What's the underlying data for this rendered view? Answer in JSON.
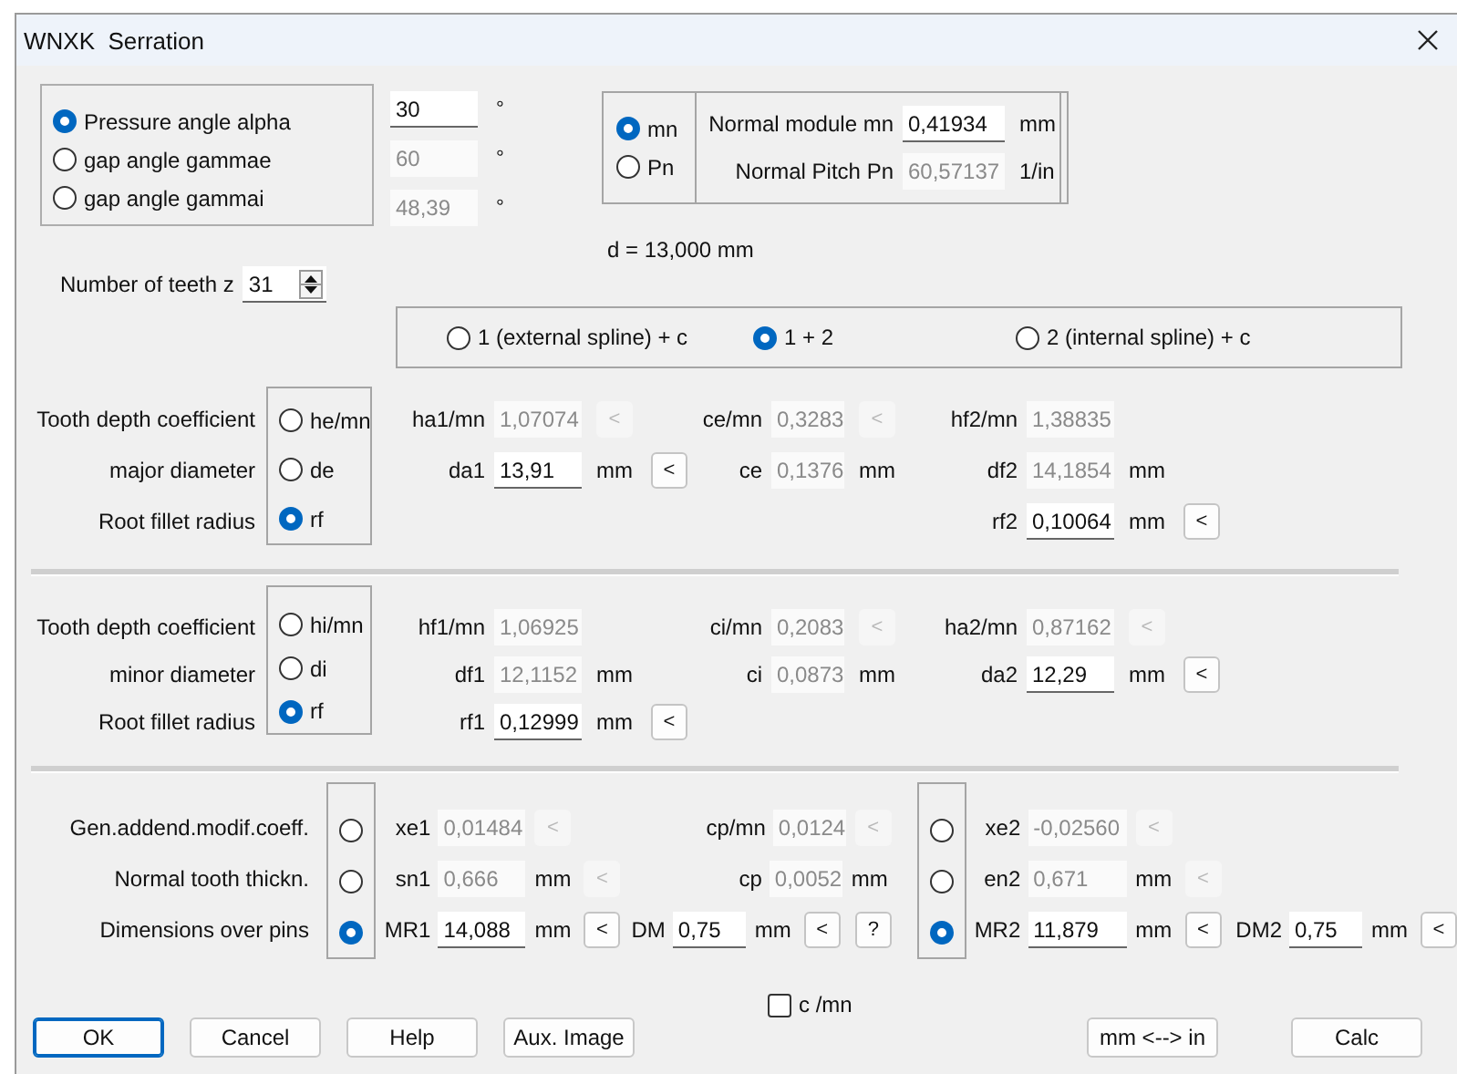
{
  "window": {
    "title": "WNXK  Serration"
  },
  "angle": {
    "options": [
      {
        "label": "Pressure angle alpha",
        "selected": true,
        "value": "30",
        "unit": "°",
        "disabled": false
      },
      {
        "label": "gap angle gammae",
        "selected": false,
        "value": "60",
        "unit": "°",
        "disabled": true
      },
      {
        "label": "gap angle gammai",
        "selected": false,
        "value": "48,39",
        "unit": "°",
        "disabled": true
      }
    ]
  },
  "module": {
    "options": [
      {
        "label": "mn",
        "selected": true
      },
      {
        "label": "Pn",
        "selected": false
      }
    ],
    "fields": [
      {
        "label": "Normal module mn",
        "value": "0,41934",
        "unit": "mm",
        "disabled": false
      },
      {
        "label": "Normal Pitch Pn",
        "value": "60,57137",
        "unit": "1/in",
        "disabled": true
      }
    ]
  },
  "diameter": "d = 13,000 mm",
  "teeth": {
    "label": "Number of teeth z",
    "value": "31"
  },
  "combination": {
    "options": [
      {
        "label": "1 (external spline) + c",
        "selected": false
      },
      {
        "label": "1 + 2",
        "selected": true
      },
      {
        "label": "2 (internal spline) + c",
        "selected": false
      }
    ]
  },
  "sections": [
    {
      "rows": [
        {
          "label": "Tooth depth coefficient",
          "option": "he/mn",
          "selected": false,
          "left": [
            {
              "name": "ha1/mn",
              "value": "1,07074",
              "disabled": true,
              "buttons": [
                {
                  "label": "<",
                  "disabled": true
                }
              ]
            }
          ],
          "middle": [
            {
              "name": "ce/mn",
              "value": "0,3283",
              "disabled": true,
              "buttons": [
                {
                  "label": "<",
                  "disabled": true
                }
              ]
            }
          ],
          "right": [
            {
              "name": "hf2/mn",
              "value": "1,38835",
              "disabled": true
            }
          ]
        },
        {
          "label": "major diameter",
          "option": "de",
          "selected": false,
          "left": [
            {
              "name": "da1",
              "value": "13,91",
              "disabled": false,
              "unit": "mm",
              "buttons": [
                {
                  "label": "<",
                  "disabled": false
                }
              ]
            }
          ],
          "middle": [
            {
              "name": "ce",
              "value": "0,1376",
              "disabled": true,
              "unit": "mm"
            }
          ],
          "right": [
            {
              "name": "df2",
              "value": "14,1854",
              "disabled": true,
              "unit": "mm"
            }
          ]
        },
        {
          "label": "Root fillet radius",
          "option": "rf",
          "selected": true,
          "right": [
            {
              "name": "rf2",
              "value": "0,10064",
              "disabled": false,
              "unit": "mm",
              "buttons": [
                {
                  "label": "<",
                  "disabled": false
                }
              ]
            }
          ]
        }
      ]
    },
    {
      "rows": [
        {
          "label": "Tooth depth coefficient",
          "option": "hi/mn",
          "selected": false,
          "left": [
            {
              "name": "hf1/mn",
              "value": "1,06925",
              "disabled": true
            }
          ],
          "middle": [
            {
              "name": "ci/mn",
              "value": "0,2083",
              "disabled": true,
              "buttons": [
                {
                  "label": "<",
                  "disabled": true
                }
              ]
            }
          ],
          "right": [
            {
              "name": "ha2/mn",
              "value": "0,87162",
              "disabled": true,
              "buttons": [
                {
                  "label": "<",
                  "disabled": true
                }
              ]
            }
          ]
        },
        {
          "label": "minor diameter",
          "option": "di",
          "selected": false,
          "left": [
            {
              "name": "df1",
              "value": "12,1152",
              "disabled": true,
              "unit": "mm"
            }
          ],
          "middle": [
            {
              "name": "ci",
              "value": "0,0873",
              "disabled": true,
              "unit": "mm"
            }
          ],
          "right": [
            {
              "name": "da2",
              "value": "12,29",
              "disabled": false,
              "unit": "mm",
              "buttons": [
                {
                  "label": "<",
                  "disabled": false
                }
              ]
            }
          ]
        },
        {
          "label": "Root fillet radius",
          "option": "rf",
          "selected": true,
          "left": [
            {
              "name": "rf1",
              "value": "0,12999",
              "disabled": false,
              "unit": "mm",
              "buttons": [
                {
                  "label": "<",
                  "disabled": false
                }
              ]
            }
          ]
        }
      ]
    }
  ],
  "pins": {
    "rows": [
      {
        "label": "Gen.addend.modif.coeff.",
        "left_selected": false,
        "right_selected": false,
        "left": [
          {
            "name": "xe1",
            "value": "0,01484",
            "disabled": true,
            "buttons": [
              {
                "label": "<",
                "disabled": true
              }
            ]
          }
        ],
        "middle": [
          {
            "name": "cp/mn",
            "value": "0,0124",
            "disabled": true,
            "buttons": [
              {
                "label": "<",
                "disabled": true
              }
            ]
          }
        ],
        "right": [
          {
            "name": "xe2",
            "value": "-0,02560",
            "disabled": true,
            "buttons": [
              {
                "label": "<",
                "disabled": true
              }
            ]
          }
        ]
      },
      {
        "label": "Normal tooth thickn.",
        "left_selected": false,
        "right_selected": false,
        "left": [
          {
            "name": "sn1",
            "value": "0,666",
            "disabled": true,
            "unit": "mm",
            "buttons": [
              {
                "label": "<",
                "disabled": true
              }
            ]
          }
        ],
        "middle": [
          {
            "name": "cp",
            "value": "0,0052",
            "disabled": true,
            "unit": "mm"
          }
        ],
        "right": [
          {
            "name": "en2",
            "value": "0,671",
            "disabled": true,
            "unit": "mm",
            "buttons": [
              {
                "label": "<",
                "disabled": true
              }
            ]
          }
        ]
      },
      {
        "label": "Dimensions over pins",
        "left_selected": true,
        "right_selected": true,
        "left": [
          {
            "name": "MR1",
            "value": "14,088",
            "disabled": false,
            "unit": "mm",
            "buttons": [
              {
                "label": "<",
                "disabled": false
              }
            ]
          }
        ],
        "middle": [
          {
            "name": "DM",
            "value": "0,75",
            "disabled": false,
            "unit": "mm",
            "buttons": [
              {
                "label": "<",
                "disabled": false
              },
              {
                "label": "?",
                "disabled": false
              }
            ]
          }
        ],
        "right": [
          {
            "name": "MR2",
            "value": "11,879",
            "disabled": false,
            "unit": "mm",
            "buttons": [
              {
                "label": "<",
                "disabled": false
              }
            ]
          },
          {
            "name": "DM2",
            "value": "0,75",
            "disabled": false,
            "unit": "mm",
            "buttons": [
              {
                "label": "<",
                "disabled": false
              }
            ]
          }
        ]
      }
    ]
  },
  "footer": {
    "checkbox": {
      "label": "c /mn",
      "checked": false
    },
    "left_buttons": [
      {
        "label": "OK",
        "default": true
      },
      {
        "label": "Cancel",
        "default": false
      },
      {
        "label": "Help",
        "default": false
      },
      {
        "label": "Aux. Image",
        "default": false
      }
    ],
    "right_buttons": [
      {
        "label": "mm <--> in",
        "default": false
      },
      {
        "label": "Calc",
        "default": false
      }
    ]
  }
}
